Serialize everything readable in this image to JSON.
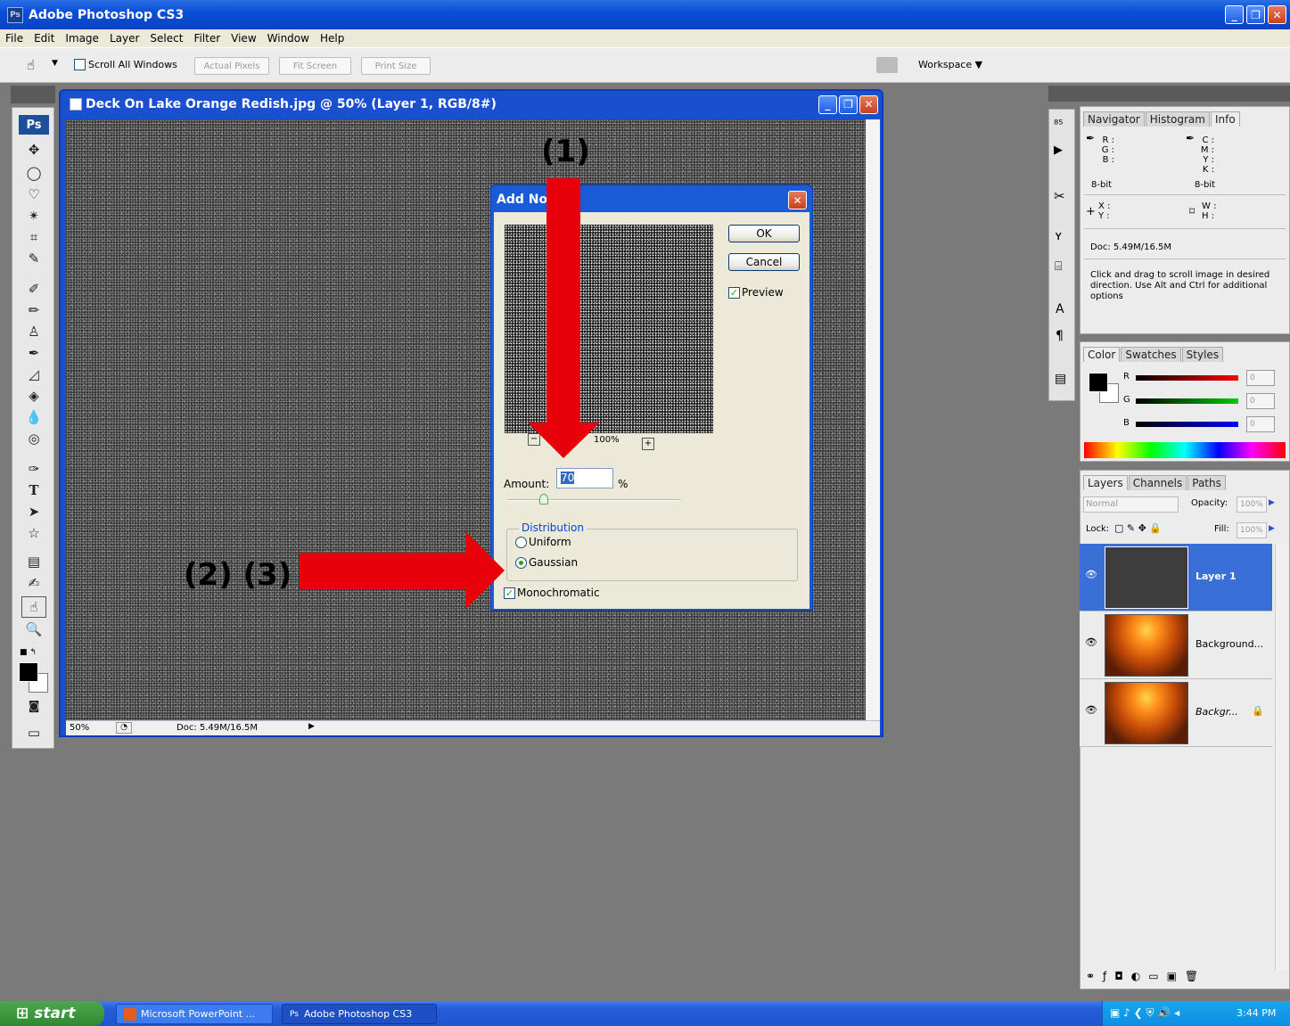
{
  "app": {
    "title": "Adobe Photoshop CS3",
    "icon": "Ps"
  },
  "window_controls": {
    "minimize": "_",
    "restore": "❐",
    "close": "✕"
  },
  "menu": [
    "File",
    "Edit",
    "Image",
    "Layer",
    "Select",
    "Filter",
    "View",
    "Window",
    "Help"
  ],
  "options_bar": {
    "scroll_all_windows_label": "Scroll All Windows",
    "actual_pixels": "Actual Pixels",
    "fit_screen": "Fit Screen",
    "print_size": "Print Size",
    "workspace": "Workspace"
  },
  "document": {
    "title": "Deck On Lake Orange Redish.jpg @ 50% (Layer 1, RGB/8#)",
    "zoom": "50%",
    "doc_size": "Doc: 5.49M/16.5M"
  },
  "dialog": {
    "title": "Add Noise",
    "ok": "OK",
    "cancel": "Cancel",
    "preview_label": "Preview",
    "preview_zoom": "100%",
    "amount_label": "Amount:",
    "amount_value": "70",
    "amount_unit": "%",
    "amount_slider_fraction": 0.18,
    "distribution_label": "Distribution",
    "uniform_label": "Uniform",
    "gaussian_label": "Gaussian",
    "monochromatic_label": "Monochromatic",
    "selected_distribution": "Gaussian",
    "preview_checked": true,
    "monochromatic_checked": true
  },
  "annotations": {
    "step1": "(1)",
    "step23": "(2) (3)",
    "arrow_color": "#e8000b"
  },
  "info_panel": {
    "tabs": [
      "Navigator",
      "Histogram",
      "Info"
    ],
    "rgb": [
      "R :",
      "G :",
      "B :"
    ],
    "cmyk": [
      "C :",
      "M :",
      "Y :",
      "K :"
    ],
    "bitdepth_left": "8-bit",
    "bitdepth_right": "8-bit",
    "xy": [
      "X :",
      "Y :"
    ],
    "wh": [
      "W :",
      "H :"
    ],
    "doc": "Doc: 5.49M/16.5M",
    "hint": "Click and drag to scroll image in desired direction. Use Alt and Ctrl for additional options"
  },
  "color_panel": {
    "tabs": [
      "Color",
      "Swatches",
      "Styles"
    ],
    "channels": [
      {
        "label": "R",
        "value": "0",
        "color": "#ff0000"
      },
      {
        "label": "G",
        "value": "0",
        "color": "#00cc00"
      },
      {
        "label": "B",
        "value": "0",
        "color": "#0000ff"
      }
    ]
  },
  "layers_panel": {
    "tabs": [
      "Layers",
      "Channels",
      "Paths"
    ],
    "blend_mode": "Normal",
    "opacity_label": "Opacity:",
    "opacity_value": "100%",
    "lock_label": "Lock:",
    "fill_label": "Fill:",
    "fill_value": "100%",
    "layers": [
      {
        "name": "Layer 1",
        "selected": true
      },
      {
        "name": "Background...",
        "selected": false
      },
      {
        "name": "Backgr...",
        "selected": false
      }
    ]
  },
  "taskbar": {
    "start": "start",
    "tasks": [
      "Microsoft PowerPoint ...",
      "Adobe Photoshop CS3"
    ],
    "time": "3:44 PM"
  }
}
